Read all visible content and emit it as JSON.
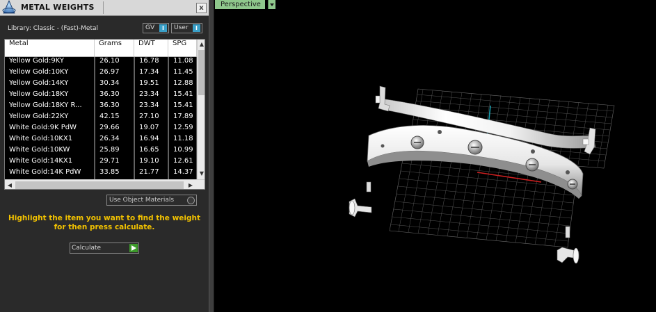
{
  "panel": {
    "title": "METAL WEIGHTS",
    "close_label": "x",
    "library_label": "Library: Classic - (Fast)-Metal",
    "gv_toggle": {
      "label": "GV",
      "state_glyph": "I"
    },
    "user_toggle": {
      "label": "User",
      "state_glyph": "I"
    },
    "table": {
      "columns": [
        "Metal",
        "Grams",
        "DWT",
        "SPG"
      ],
      "rows": [
        [
          "Yellow Gold:9KY",
          "26.10",
          "16.78",
          "11.08"
        ],
        [
          "Yellow Gold:10KY",
          "26.97",
          "17.34",
          "11.45"
        ],
        [
          "Yellow Gold:14KY",
          "30.34",
          "19.51",
          "12.88"
        ],
        [
          "Yellow Gold:18KY",
          "36.30",
          "23.34",
          "15.41"
        ],
        [
          "Yellow Gold:18KY R...",
          "36.30",
          "23.34",
          "15.41"
        ],
        [
          "Yellow Gold:22KY",
          "42.15",
          "27.10",
          "17.89"
        ],
        [
          "White Gold:9K PdW",
          "29.66",
          "19.07",
          "12.59"
        ],
        [
          "White Gold:10KX1",
          "26.34",
          "16.94",
          "11.18"
        ],
        [
          "White Gold:10KW",
          "25.89",
          "16.65",
          "10.99"
        ],
        [
          "White Gold:14KX1",
          "29.71",
          "19.10",
          "12.61"
        ],
        [
          "White Gold:14K PdW",
          "33.85",
          "21.77",
          "14.37"
        ]
      ],
      "scroll_up_glyph": "▲",
      "scroll_down_glyph": "▼",
      "scroll_left_glyph": "◀",
      "scroll_right_glyph": "▶"
    },
    "use_object_materials_label": "Use Object Materials",
    "instructions": "Highlight the item you want to find the weight for then press calculate.",
    "calculate_label": "Calculate"
  },
  "viewport": {
    "view_label": "Perspective"
  },
  "colors": {
    "panel_bg": "#2a2a2a",
    "instruction_text": "#f2c200",
    "toggle_accent": "#3aa0c8",
    "view_tab": "#8fc88c",
    "calculate_play": "#3c9a2a",
    "axis_x": "#cc2020",
    "axis_y": "#1aa0b0"
  },
  "icons": {
    "app_logo": "metal-weights-logo-icon",
    "close": "close-icon",
    "calculate": "play-icon",
    "view_dropdown": "chevron-down-icon"
  }
}
